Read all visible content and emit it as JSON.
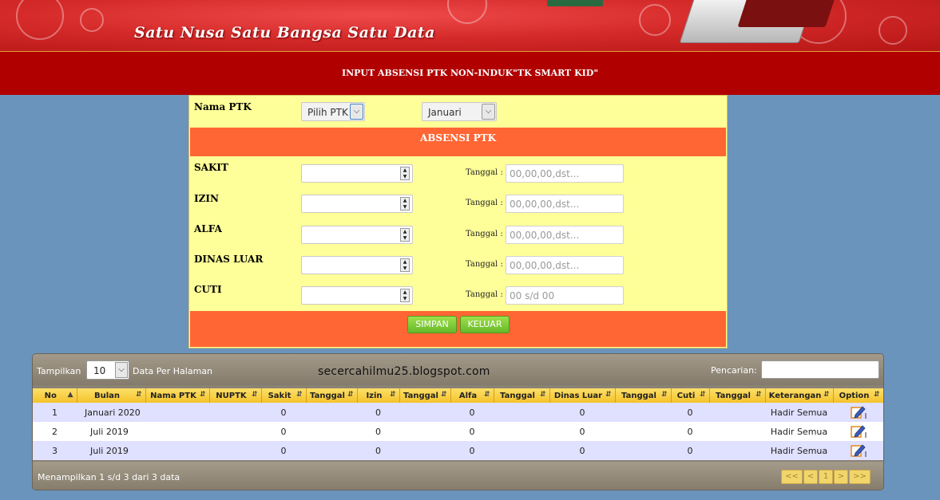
{
  "banner": {
    "tagline": "Satu Nusa Satu Bangsa Satu Data"
  },
  "header": {
    "title": "INPUT ABSENSI PTK NON-INDUK\"TK SMART KID\""
  },
  "form": {
    "nama_ptk_label": "Nama PTK",
    "pilih_ptk": "Pilih PTK",
    "bulan": "Januari",
    "section_title": "ABSENSI PTK",
    "tanggal_label": "Tanggal :",
    "fields": [
      {
        "label": "SAKIT",
        "placeholder": "00,00,00,dst..."
      },
      {
        "label": "IZIN",
        "placeholder": "00,00,00,dst..."
      },
      {
        "label": "ALFA",
        "placeholder": "00,00,00,dst..."
      },
      {
        "label": "DINAS LUAR",
        "placeholder": "00,00,00,dst..."
      },
      {
        "label": "CUTI",
        "placeholder": "00 s/d 00"
      }
    ],
    "simpan_label": "SIMPAN",
    "keluar_label": "KELUAR"
  },
  "table": {
    "show_label": "Tampilkan",
    "page_length": "10",
    "per_page_label": "Data Per Halaman",
    "watermark": "secercahilmu25.blogspot.com",
    "search_label": "Pencarian:",
    "columns": [
      "No",
      "Bulan",
      "Nama PTK",
      "NUPTK",
      "Sakit",
      "Tanggal",
      "Izin",
      "Tanggal",
      "Alfa",
      "Tanggal",
      "Dinas Luar",
      "Tanggal",
      "Cuti",
      "Tanggal",
      "Keterangan",
      "Option"
    ],
    "rows": [
      {
        "no": "1",
        "bulan": "Januari 2020",
        "nama": "",
        "nuptk": "",
        "sakit": "0",
        "tgl1": "",
        "izin": "0",
        "tgl2": "",
        "alfa": "0",
        "tgl3": "",
        "dinas": "0",
        "tgl4": "",
        "cuti": "0",
        "tgl5": "",
        "ket": "Hadir Semua"
      },
      {
        "no": "2",
        "bulan": "  Juli 2019",
        "nama": "",
        "nuptk": "",
        "sakit": "0",
        "tgl1": "",
        "izin": "0",
        "tgl2": "",
        "alfa": "0",
        "tgl3": "",
        "dinas": "0",
        "tgl4": "",
        "cuti": "0",
        "tgl5": "",
        "ket": "Hadir Semua"
      },
      {
        "no": "3",
        "bulan": "  Juli 2019",
        "nama": "",
        "nuptk": "",
        "sakit": "0",
        "tgl1": "",
        "izin": "0",
        "tgl2": "",
        "alfa": "0",
        "tgl3": "",
        "dinas": "0",
        "tgl4": "",
        "cuti": "0",
        "tgl5": "",
        "ket": "Hadir Semua"
      }
    ],
    "info": "Menampilkan 1 s/d 3 dari 3 data",
    "pager": {
      "first": "<<",
      "prev": "<",
      "page": "1",
      "next": ">",
      "last": ">>"
    }
  },
  "icons": {
    "edit": "edit-pencil-icon",
    "sort": "sort-icon"
  },
  "colors": {
    "banner": "#d52a2a",
    "titlebar": "#b10000",
    "form_bg": "#ffff99",
    "orange": "#ff6633",
    "green_button": "#66b82a",
    "table_header": "#f4c22a"
  }
}
